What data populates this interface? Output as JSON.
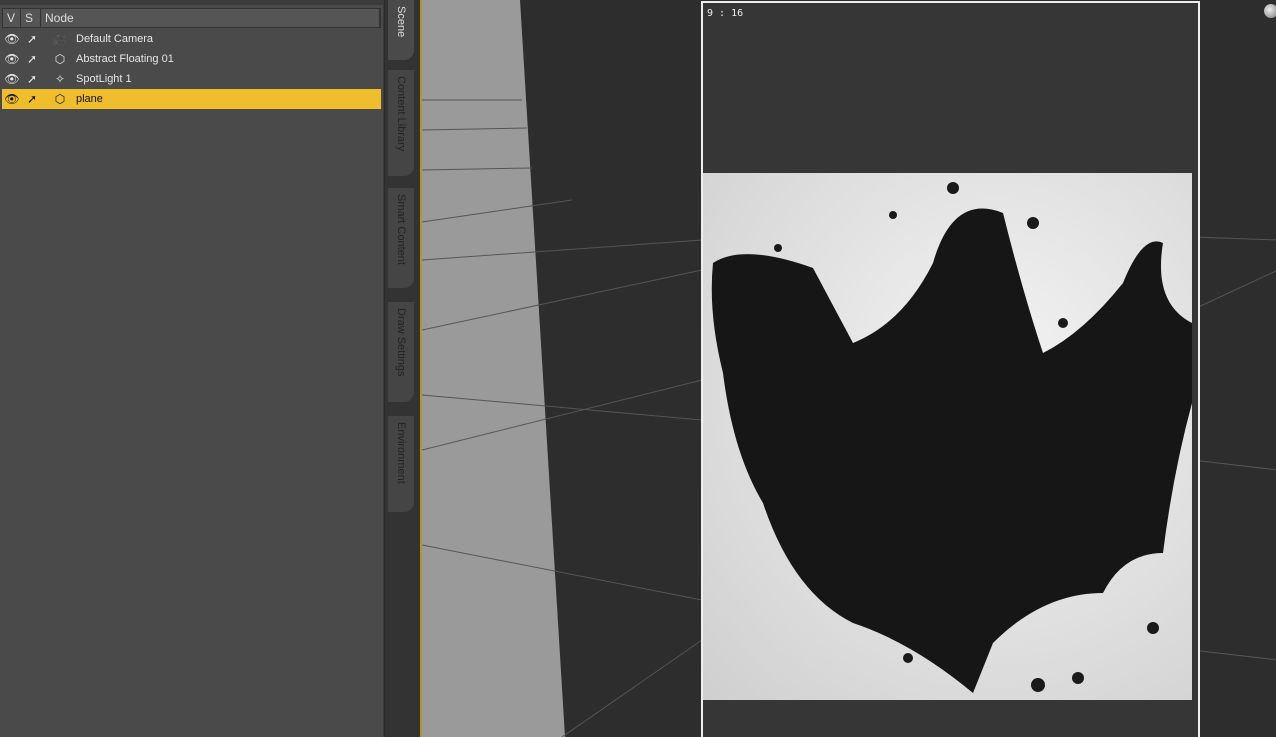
{
  "scene": {
    "columns": [
      "V",
      "S",
      "Node"
    ],
    "nodes": [
      {
        "name": "Default Camera",
        "icon": "camera-icon",
        "selected": false
      },
      {
        "name": "Abstract Floating 01",
        "icon": "cube-icon",
        "selected": false
      },
      {
        "name": "SpotLight 1",
        "icon": "spotlight-icon",
        "selected": false
      },
      {
        "name": "plane",
        "icon": "cube-icon",
        "selected": true
      }
    ]
  },
  "side_tabs": [
    "Scene",
    "Content Library",
    "Smart Content",
    "Draw Settings",
    "Environment"
  ],
  "viewport": {
    "aspect_ratio": "9 : 16"
  },
  "colors": {
    "selection": "#f0be2c",
    "viewport_border": "#b8942c"
  }
}
